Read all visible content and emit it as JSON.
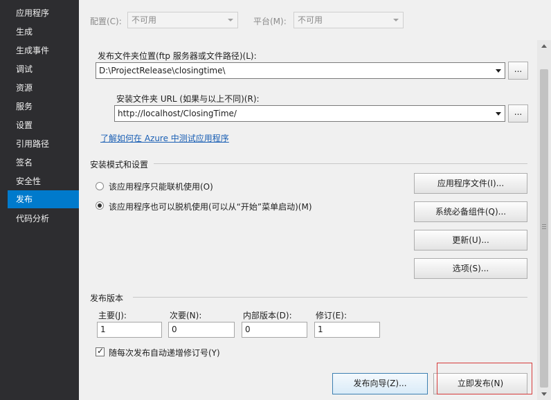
{
  "sidebar": {
    "items": [
      {
        "label": "应用程序"
      },
      {
        "label": "生成"
      },
      {
        "label": "生成事件"
      },
      {
        "label": "调试"
      },
      {
        "label": "资源"
      },
      {
        "label": "服务"
      },
      {
        "label": "设置"
      },
      {
        "label": "引用路径"
      },
      {
        "label": "签名"
      },
      {
        "label": "安全性"
      },
      {
        "label": "发布"
      },
      {
        "label": "代码分析"
      }
    ],
    "active_index": 10
  },
  "topbar": {
    "config_label": "配置(C):",
    "config_value": "不可用",
    "platform_label": "平台(M):",
    "platform_value": "不可用"
  },
  "publish": {
    "folder_label": "发布文件夹位置(ftp 服务器或文件路径)(L):",
    "folder_value": "D:\\ProjectRelease\\closingtime\\",
    "install_url_label": "安装文件夹 URL (如果与以上不同)(R):",
    "install_url_value": "http://localhost/ClosingTime/",
    "browse_label": "...",
    "azure_link": "了解如何在 Azure 中测试应用程序"
  },
  "install_mode": {
    "section_title": "安装模式和设置",
    "online_only": "该应用程序只能联机使用(O)",
    "offline_available": "该应用程序也可以脱机使用(可以从“开始”菜单启动)(M)",
    "selected": "offline_available"
  },
  "buttons": {
    "app_files": "应用程序文件(I)...",
    "prerequisites": "系统必备组件(Q)...",
    "updates": "更新(U)...",
    "options": "选项(S)...",
    "publish_wizard": "发布向导(Z)...",
    "publish_now": "立即发布(N)"
  },
  "version": {
    "section_title": "发布版本",
    "major_label": "主要(J):",
    "major_value": "1",
    "minor_label": "次要(N):",
    "minor_value": "0",
    "build_label": "内部版本(D):",
    "build_value": "0",
    "revision_label": "修订(E):",
    "revision_value": "1",
    "auto_increment_label": "随每次发布自动递增修订号(Y)",
    "auto_increment_checked": true
  },
  "colors": {
    "sidebar_bg": "#2d2d30",
    "accent": "#007acc",
    "highlight": "#d63a3a"
  }
}
